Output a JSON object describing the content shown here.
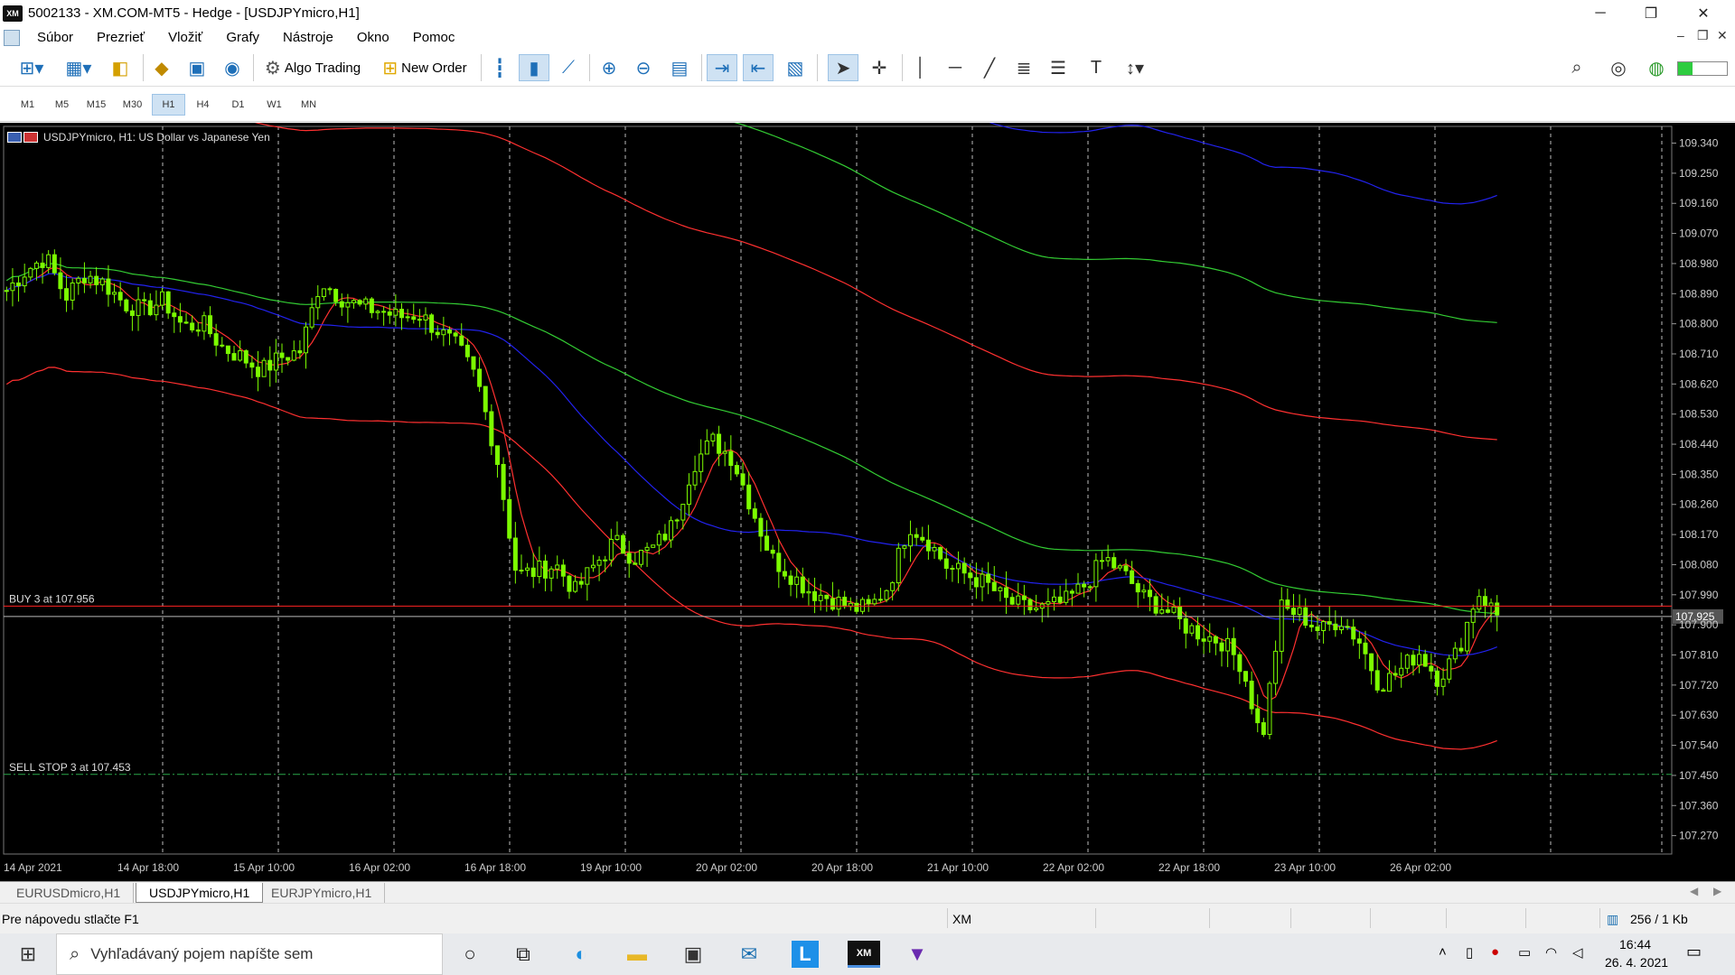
{
  "window": {
    "title": "5002133 - XM.COM-MT5 - Hedge - [USDJPYmicro,H1]",
    "logo_text": "XM",
    "minimize": "─",
    "restore": "❐",
    "close": "✕"
  },
  "menu": {
    "items": [
      "Súbor",
      "Prezrieť",
      "Vložiť",
      "Grafy",
      "Nástroje",
      "Okno",
      "Pomoc"
    ]
  },
  "toolbar": {
    "algo_trading": "Algo Trading",
    "new_order": "New Order"
  },
  "timeframes": [
    "M1",
    "M5",
    "M15",
    "M30",
    "H1",
    "H4",
    "D1",
    "W1",
    "MN"
  ],
  "active_timeframe": "H1",
  "chart_data": {
    "type": "candlestick",
    "symbol_label": "USDJPYmicro, H1:  US Dollar vs Japanese Yen",
    "y_ticks": [
      "109.340",
      "109.250",
      "109.160",
      "109.070",
      "108.980",
      "108.890",
      "108.800",
      "108.710",
      "108.620",
      "108.530",
      "108.440",
      "108.350",
      "108.260",
      "108.170",
      "108.080",
      "107.990",
      "107.900",
      "107.810",
      "107.720",
      "107.630",
      "107.540",
      "107.450",
      "107.360",
      "107.270"
    ],
    "ylim": [
      107.215,
      109.39
    ],
    "x_ticks": [
      "14 Apr 2021",
      "14 Apr 18:00",
      "15 Apr 10:00",
      "16 Apr 02:00",
      "16 Apr 18:00",
      "19 Apr 10:00",
      "20 Apr 02:00",
      "20 Apr 18:00",
      "21 Apr 10:00",
      "22 Apr 02:00",
      "22 Apr 18:00",
      "23 Apr 10:00",
      "26 Apr 02:00"
    ],
    "current_price": "107.925",
    "current_price_value": 107.925,
    "orders": [
      {
        "label": "BUY 3 at 107.956",
        "price": 107.956
      },
      {
        "label": "SELL STOP 3 at 107.453",
        "price": 107.453
      }
    ],
    "close_path": [
      108.9,
      108.96,
      109.0,
      108.88,
      108.95,
      108.92,
      108.86,
      108.84,
      108.87,
      108.79,
      108.8,
      108.73,
      108.7,
      108.66,
      108.7,
      108.72,
      108.93,
      108.88,
      108.85,
      108.84,
      108.82,
      108.83,
      108.78,
      108.73,
      108.63,
      108.4,
      108.05,
      108.06,
      108.08,
      108.0,
      108.08,
      108.15,
      108.1,
      108.13,
      108.2,
      108.38,
      108.45,
      108.4,
      108.25,
      108.1,
      108.05,
      108.0,
      107.98,
      107.95,
      107.95,
      108.02,
      108.2,
      108.15,
      108.07,
      108.05,
      108.02,
      107.97,
      107.95,
      107.95,
      107.97,
      108.02,
      108.1,
      108.05,
      107.98,
      107.95,
      107.9,
      107.87,
      107.85,
      107.78,
      107.55,
      107.95,
      107.93,
      107.88,
      107.92,
      107.85,
      107.72,
      107.76,
      107.82,
      107.74,
      107.82,
      108.0,
      107.93
    ],
    "colors": {
      "candle": "#7CFC00",
      "grid": "#bbbbbb",
      "axis_text": "#cccccc",
      "price_line": "#ff2222",
      "ma_red": "#ff3030",
      "ma_green": "#33cc33",
      "ma_blue": "#2222ee"
    }
  },
  "chart_tabs": [
    "EURUSDmicro,H1",
    "USDJPYmicro,H1",
    "EURJPYmicro,H1"
  ],
  "active_chart_tab": "USDJPYmicro,H1",
  "status": {
    "help": "Pre nápovedu stlačte F1",
    "broker": "XM",
    "traffic": "256 / 1 Kb"
  },
  "taskbar": {
    "search_placeholder": "Vyhľadávaný pojem napíšte sem",
    "time": "16:44",
    "date": "26. 4. 2021"
  }
}
